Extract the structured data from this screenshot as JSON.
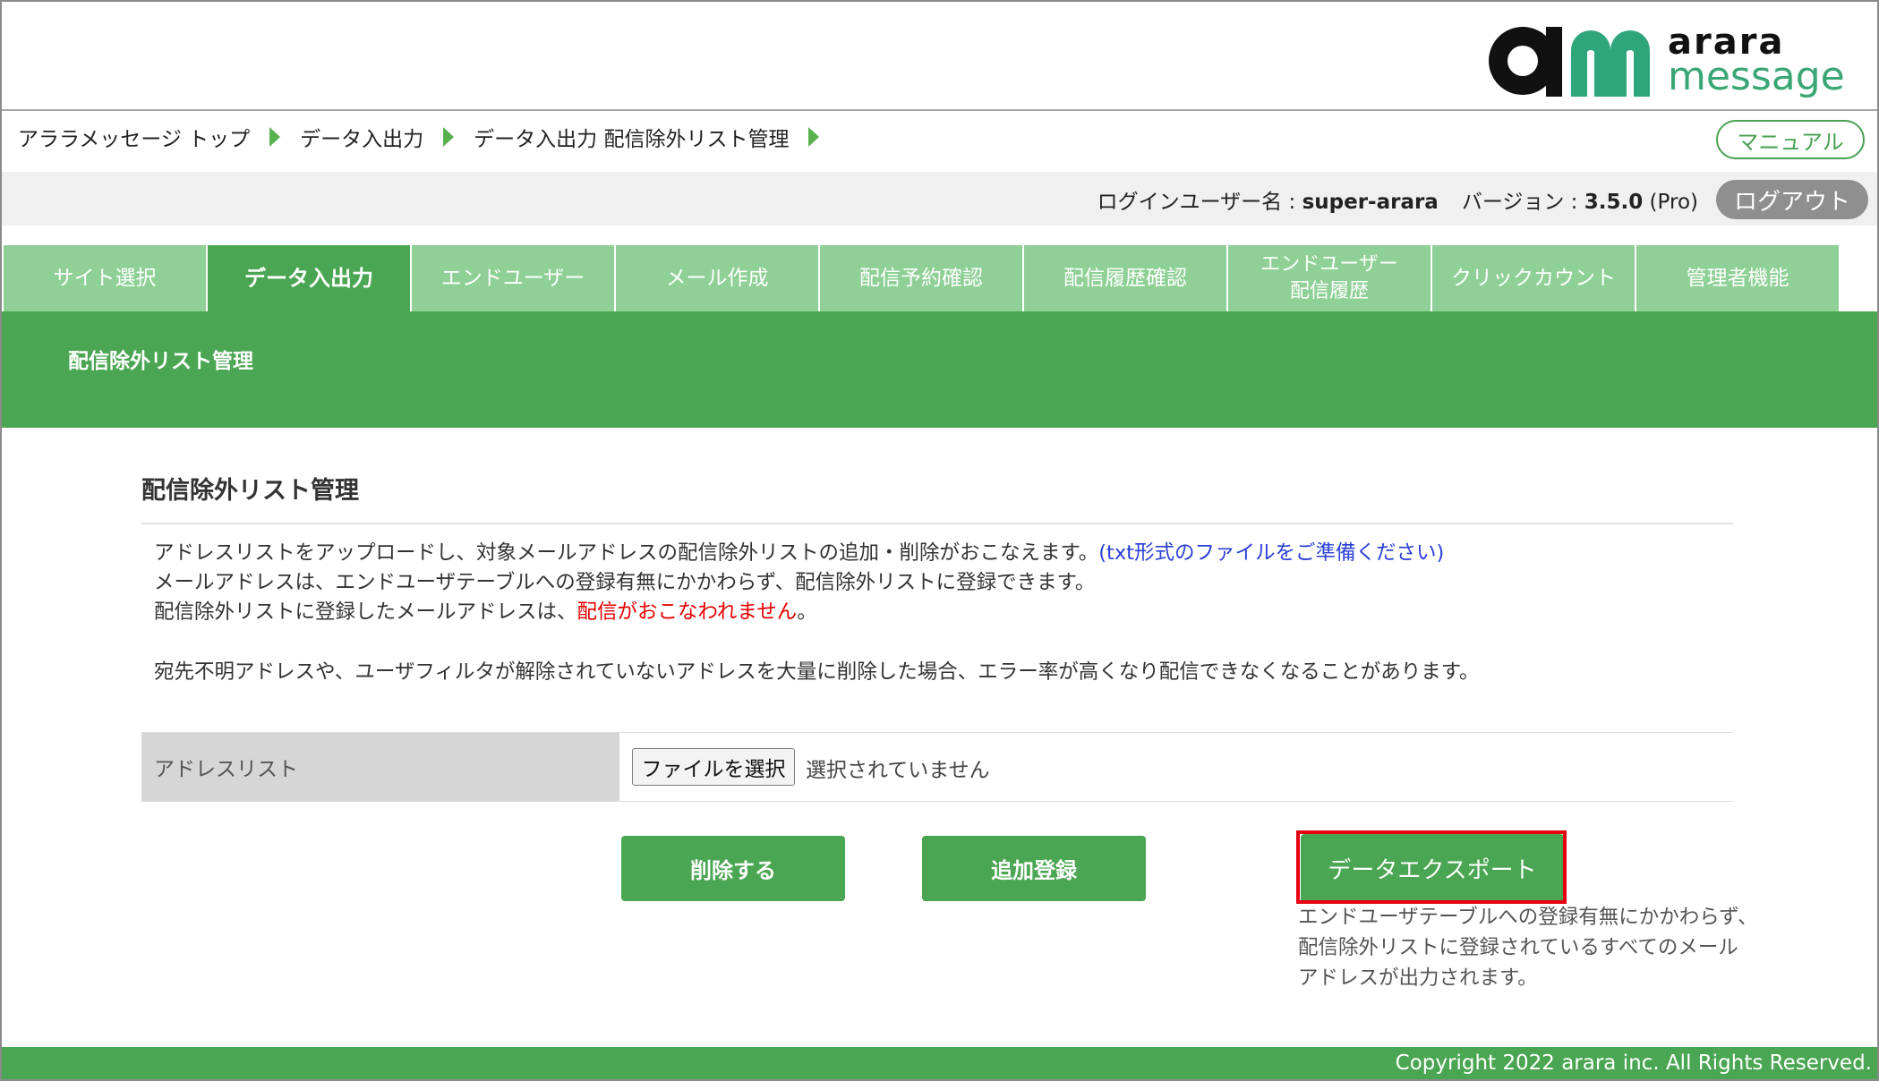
{
  "brand": {
    "logo_line1": "arara",
    "logo_line2": "message",
    "colors": {
      "mark_dark": "#111111",
      "mark_green": "#2fa67a",
      "text_green": "#3aa675"
    }
  },
  "breadcrumb": [
    "アララメッセージ トップ",
    "データ入出力",
    "データ入出力 配信除外リスト管理"
  ],
  "manual_label": "マニュアル",
  "userbar": {
    "login_label": "ログインユーザー名 : ",
    "username": "super-arara",
    "version_label": "バージョン : ",
    "version": "3.5.0",
    "edition": " (Pro)",
    "logout_label": "ログアウト"
  },
  "tabs": [
    {
      "label": "サイト選択"
    },
    {
      "label": "データ入出力",
      "active": true
    },
    {
      "label": "エンドユーザー"
    },
    {
      "label": "メール作成"
    },
    {
      "label": "配信予約確認"
    },
    {
      "label": "配信履歴確認"
    },
    {
      "label_line1": "エンドユーザー",
      "label_line2": "配信履歴"
    },
    {
      "label": "クリックカウント"
    },
    {
      "label": "管理者機能"
    }
  ],
  "band_title": "配信除外リスト管理",
  "section_title": "配信除外リスト管理",
  "description": {
    "line1": "アドレスリストをアップロードし、対象メールアドレスの配信除外リストの追加・削除がおこなえます。",
    "line1_link": "(txt形式のファイルをご準備ください)",
    "line2": "メールアドレスは、エンドユーザテーブルへの登録有無にかかわらず、配信除外リストに登録できます。",
    "line3": "配信除外リストに登録したメールアドレスは、",
    "line3_red": "配信がおこなわれません",
    "line3_end": "。",
    "line4": "宛先不明アドレスや、ユーザフィルタが解除されていないアドレスを大量に削除した場合、エラー率が高くなり配信できなくなることがあります。"
  },
  "form": {
    "label": "アドレスリスト",
    "file_button": "ファイルを選択",
    "file_status": "選択されていません"
  },
  "buttons": {
    "delete": "削除する",
    "add": "追加登録",
    "export": "データエクスポート"
  },
  "export_note": {
    "line1": "エンドユーザテーブルへの登録有無にかかわらず、",
    "line2": "配信除外リストに登録されているすべてのメール",
    "line3": "アドレスが出力されます。"
  },
  "footer": "Copyright 2022 arara inc. All Rights Reserved.",
  "theme": {
    "green": "#4aa652",
    "tab_inactive": "#8fd096",
    "highlight": "#e60012"
  }
}
